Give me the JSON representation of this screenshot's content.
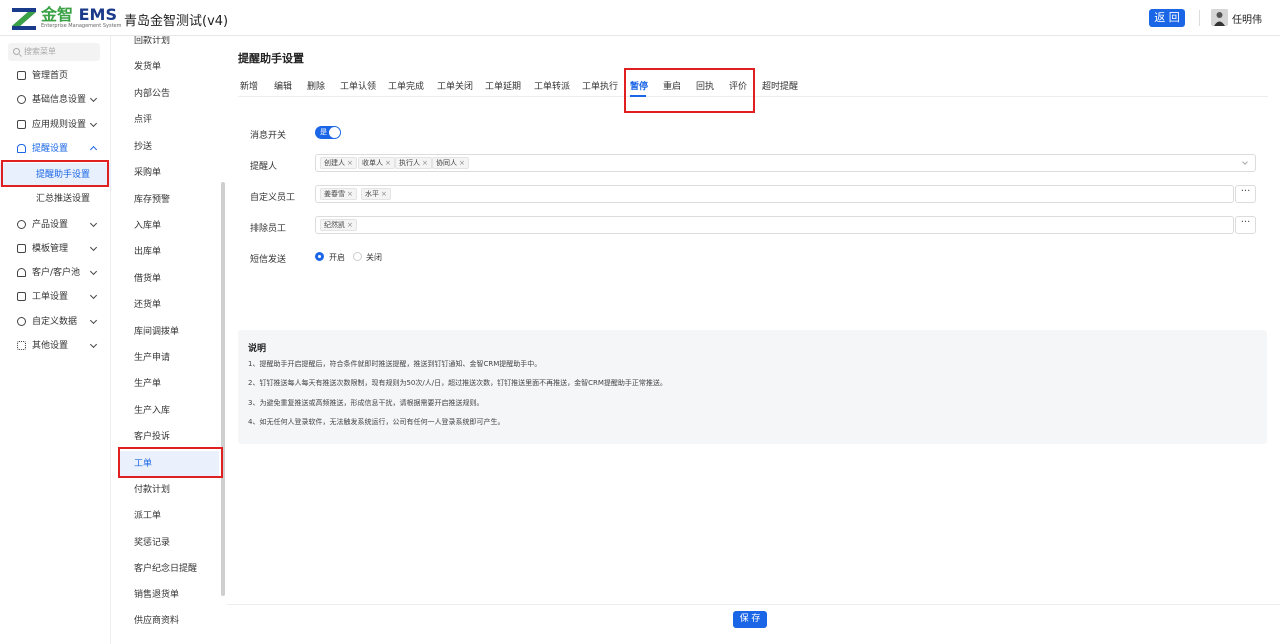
{
  "header": {
    "logo_cn": "金智",
    "logo_en": "EMS",
    "logo_sub": "Enterprise Management System",
    "company": "青岛金智测试(v4)",
    "back_label": "返 回",
    "user_name": "任明伟"
  },
  "leftnav": {
    "search_placeholder": "搜索菜单",
    "items": [
      {
        "label": "管理首页",
        "icon": "home-icon"
      },
      {
        "label": "基础信息设置",
        "icon": "cube-icon"
      },
      {
        "label": "应用规则设置",
        "icon": "document-icon"
      },
      {
        "label": "提醒设置",
        "icon": "bell-icon"
      },
      {
        "label": "提醒助手设置"
      },
      {
        "label": "汇总推送设置"
      },
      {
        "label": "产品设置",
        "icon": "box-icon"
      },
      {
        "label": "模板管理",
        "icon": "template-icon"
      },
      {
        "label": "客户/客户池",
        "icon": "users-icon"
      },
      {
        "label": "工单设置",
        "icon": "clipboard-icon"
      },
      {
        "label": "自定义数据",
        "icon": "puzzle-icon"
      },
      {
        "label": "其他设置",
        "icon": "grid-icon"
      }
    ]
  },
  "midmenu": {
    "items": [
      "回款计划",
      "发货单",
      "内部公告",
      "点评",
      "抄送",
      "采购单",
      "库存预警",
      "入库单",
      "出库单",
      "借货单",
      "还货单",
      "库间调拨单",
      "生产申请",
      "生产单",
      "生产入库",
      "客户投诉",
      "工单",
      "付款计划",
      "派工单",
      "奖惩记录",
      "客户纪念日提醒",
      "销售退货单",
      "供应商资料"
    ]
  },
  "main": {
    "title": "提醒助手设置",
    "tabs": [
      "新增",
      "编辑",
      "删除",
      "工单认领",
      "工单完成",
      "工单关闭",
      "工单延期",
      "工单转派",
      "工单执行",
      "暂停",
      "重启",
      "回执",
      "评价",
      "超时提醒"
    ],
    "active_tab": "暂停",
    "form": {
      "switch_label": "消息开关",
      "switch_value": "是",
      "reminder_label": "提醒人",
      "reminder_tags": [
        "创建人",
        "收单人",
        "执行人",
        "协同人"
      ],
      "custom_label": "自定义员工",
      "custom_tags": [
        "姜春雪",
        "水平"
      ],
      "exclude_label": "排除员工",
      "exclude_tags": [
        "纪然凯"
      ],
      "sms_label": "短信发送",
      "sms_on": "开启",
      "sms_off": "关闭",
      "more": "···"
    },
    "notes": {
      "title": "说明",
      "lines": [
        "1、提醒助手开启提醒后，符合条件就即时推送提醒，推送到钉钉通知、金智CRM提醒助手中。",
        "2、钉钉推送每人每天有推送次数限制，现有规则为50次/人/日，超过推送次数，钉钉推送里面不再推送，金智CRM提醒助手正常推送。",
        "3、为避免重复推送或高频推送，形成信息干扰，请根据需要开启推送规则。",
        "4、如无任何人登录软件，无法触发系统运行，公司有任何一人登录系统即可产生。"
      ]
    },
    "save_label": "保 存"
  }
}
